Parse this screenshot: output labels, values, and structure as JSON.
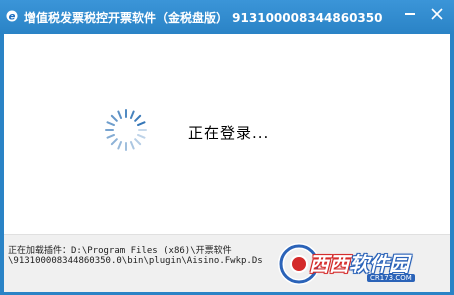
{
  "window": {
    "title": "增值税发票税控开票软件（金税盘版） 913100008344860350",
    "minimize_icon": "minimize-icon",
    "close_icon": "close-icon"
  },
  "main": {
    "login_text": "正在登录..."
  },
  "status": {
    "line1": "正在加载插件：D:\\Program Files (x86)\\开票软件",
    "line2": "\\913100008344860350.0\\bin\\plugin\\Aisino.Fwkp.Ds"
  },
  "watermark": {
    "brand_red": "西西",
    "brand_blue": "软件园",
    "url": "CR173.COM"
  },
  "colors": {
    "titlebar": "#2a83c6",
    "client_bg": "#ffffff",
    "statusbar_bg": "#f0f0f0",
    "spinner": "#2a6fb4"
  }
}
